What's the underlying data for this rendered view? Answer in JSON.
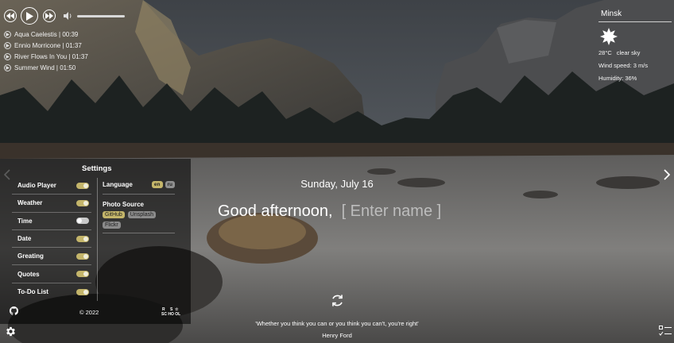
{
  "player": {
    "tracks": [
      {
        "title": "Aqua Caelestis | 00:39"
      },
      {
        "title": "Ennio Morricone | 01:37"
      },
      {
        "title": "River Flows In You | 01:37"
      },
      {
        "title": "Summer Wind | 01:50"
      }
    ],
    "volume_icon": "speaker-icon"
  },
  "weather": {
    "city": "Minsk",
    "icon": "sun-icon",
    "temperature": "28°C",
    "description": "clear sky",
    "wind": "Wind speed: 3 m/s",
    "humidity": "Humidity: 36%"
  },
  "settings": {
    "title": "Settings",
    "items": [
      {
        "label": "Audio Player",
        "on": true
      },
      {
        "label": "Weather",
        "on": true
      },
      {
        "label": "Time",
        "on": false
      },
      {
        "label": "Date",
        "on": true
      },
      {
        "label": "Greating",
        "on": true
      },
      {
        "label": "Quotes",
        "on": true
      },
      {
        "label": "To-Do List",
        "on": true
      }
    ],
    "language_label": "Language",
    "languages": [
      {
        "code": "en",
        "active": true
      },
      {
        "code": "ru",
        "active": false
      }
    ],
    "photo_label": "Photo Source",
    "photo_sources": [
      {
        "name": "GitHub",
        "active": true
      },
      {
        "name": "Unsplash",
        "active": false
      },
      {
        "name": "Flickr",
        "active": false
      }
    ],
    "copyright": "© 2022",
    "school_logo_text": "RS SCHOOL"
  },
  "main": {
    "date": "Sunday, July 16",
    "greeting": "Good afternoon,",
    "name_placeholder": "[ Enter name ]",
    "quote": "'Whether you think you can or you think you can't, you're right'",
    "author": "Henry Ford"
  },
  "colors": {
    "accent": "#c4b56a",
    "panel": "rgba(0,0,0,0.55)"
  }
}
